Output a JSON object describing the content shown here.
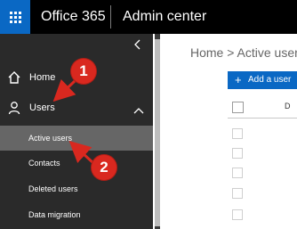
{
  "topbar": {
    "launcher_icon": "app-launcher-grid-icon",
    "app_title": "Office 365",
    "section_title": "Admin center",
    "background": "#000000",
    "launcher_color": "#0a68c4"
  },
  "sidebar": {
    "collapse_icon": "chevron-left-icon",
    "items": [
      {
        "label": "Home",
        "icon": "home-icon"
      },
      {
        "label": "Users",
        "icon": "person-icon",
        "expand_icon": "chevron-up-icon"
      }
    ],
    "subitems": [
      {
        "label": "Active users",
        "active": true
      },
      {
        "label": "Contacts"
      },
      {
        "label": "Deleted users"
      },
      {
        "label": "Data migration"
      }
    ],
    "background": "#2a2a2a",
    "active_background": "#666666"
  },
  "main": {
    "breadcrumb": "Home > Active users",
    "add_user_label": "Add a user",
    "add_user_icon": "plus-icon",
    "column_header": "D",
    "accent": "#0a68c4"
  },
  "annotations": {
    "step1": "1",
    "step2": "2",
    "color": "#d9281f"
  }
}
